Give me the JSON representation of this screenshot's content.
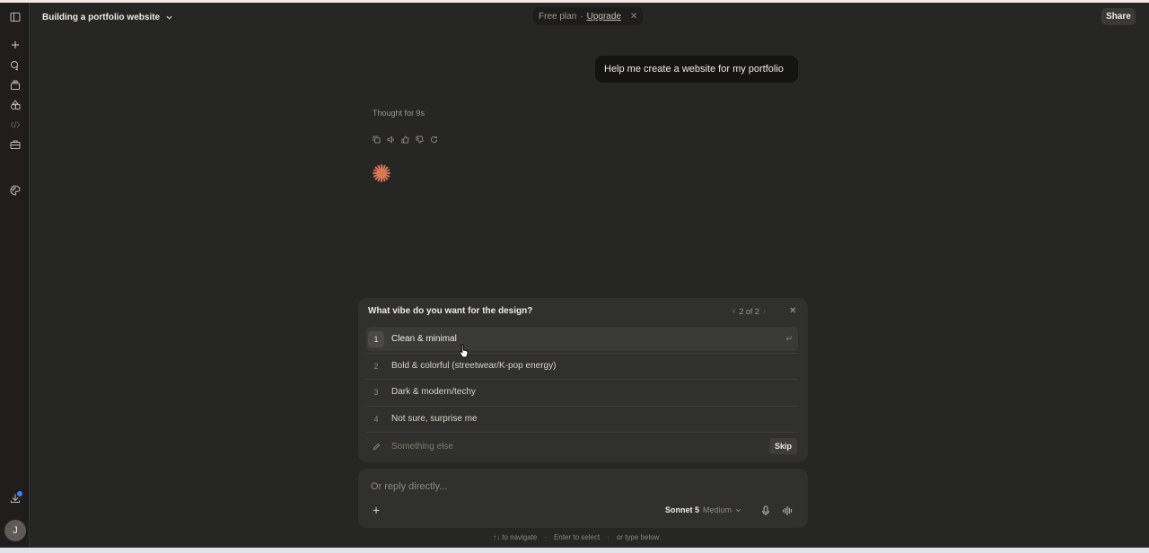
{
  "header": {
    "title": "Building a portfolio website",
    "plan_label": "Free plan",
    "plan_separator": "·",
    "upgrade_label": "Upgrade",
    "share_label": "Share"
  },
  "sidebar": {
    "icons": [
      "sidebar-toggle-icon",
      "new-chat-icon",
      "chats-icon",
      "projects-icon",
      "artifacts-icon",
      "code-icon",
      "briefcase-icon",
      "palette-icon",
      "download-icon"
    ],
    "avatar_initial": "J"
  },
  "conversation": {
    "user_message": "Help me create a website for my portfolio",
    "thought_label": "Thought for 9s"
  },
  "question": {
    "prompt": "What vibe do you want for the design?",
    "page_indicator": "2 of 2",
    "options": [
      {
        "num": "1",
        "label": "Clean & minimal"
      },
      {
        "num": "2",
        "label": "Bold & colorful (streetwear/K-pop energy)"
      },
      {
        "num": "3",
        "label": "Dark & modern/techy"
      },
      {
        "num": "4",
        "label": "Not sure, surprise me"
      }
    ],
    "other_placeholder": "Something else",
    "skip_label": "Skip"
  },
  "composer": {
    "placeholder": "Or reply directly...",
    "model_name": "Sonnet 5",
    "effort": "Medium"
  },
  "hints": {
    "navigate": "↑↓ to navigate",
    "select": "Enter to select",
    "type": "or type below",
    "separator": "·"
  },
  "colors": {
    "background": "#262624",
    "card": "#30302e",
    "accent_spark": "#d97757"
  }
}
